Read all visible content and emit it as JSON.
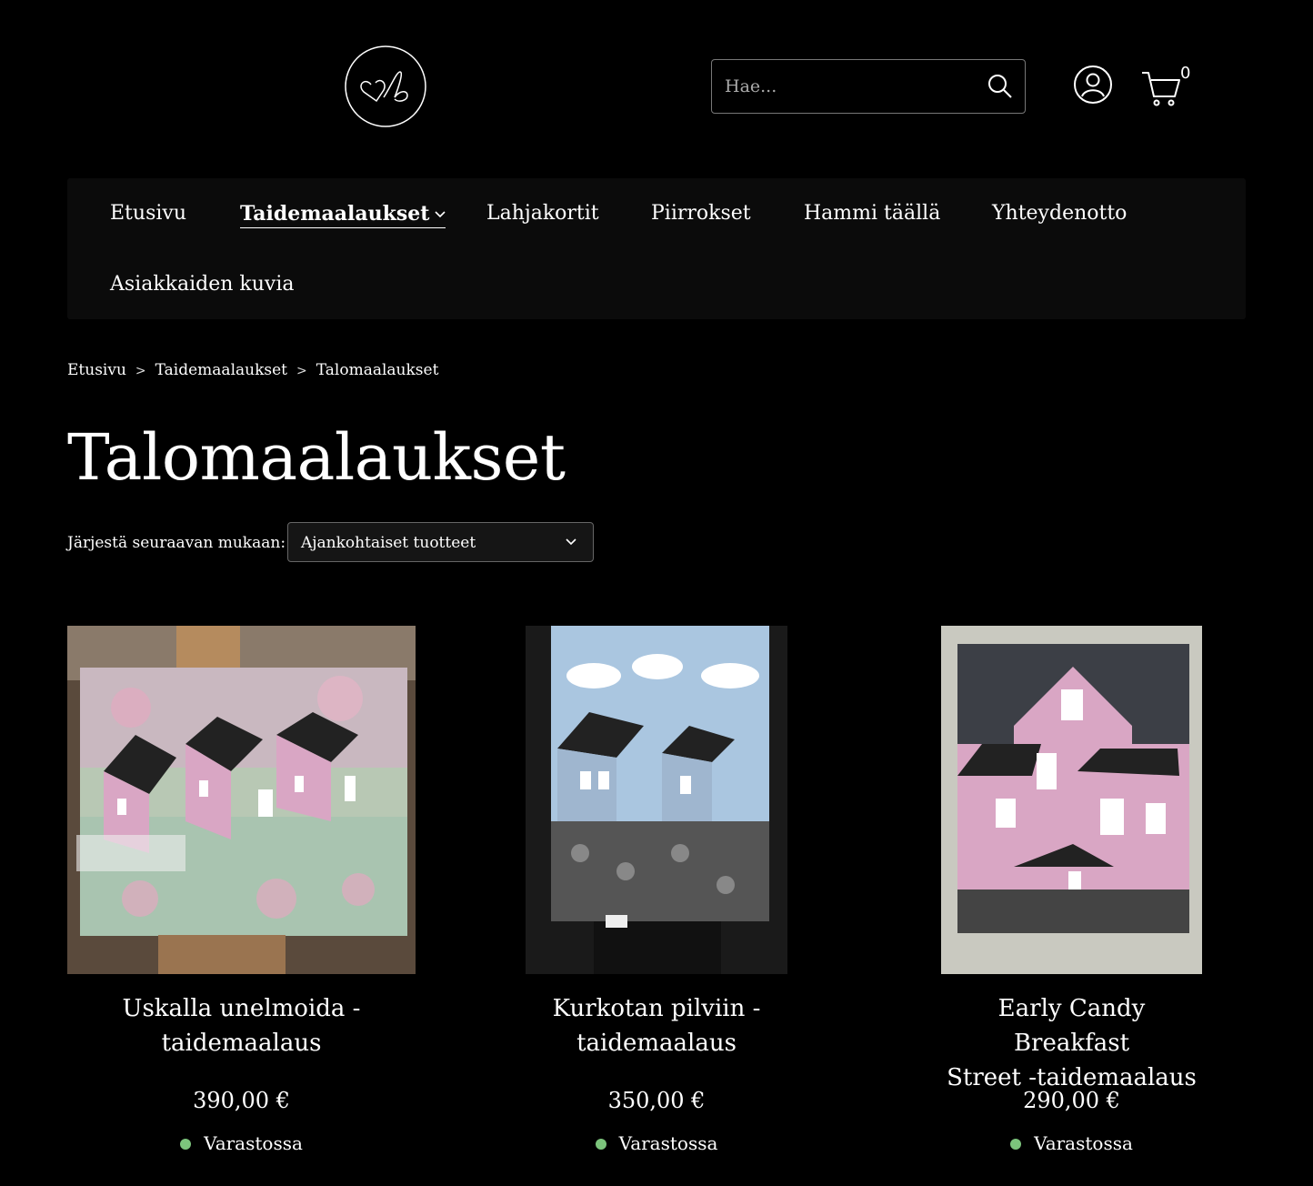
{
  "header": {
    "search_placeholder": "Hae...",
    "cart_count": "0"
  },
  "nav": {
    "items": [
      {
        "label": "Etusivu"
      },
      {
        "label": "Taidemaalaukset",
        "active": true,
        "has_dropdown": true
      },
      {
        "label": "Lahjakortit"
      },
      {
        "label": "Piirrokset"
      },
      {
        "label": "Hammi täällä"
      },
      {
        "label": "Yhteydenotto"
      },
      {
        "label": "Asiakkaiden kuvia"
      }
    ]
  },
  "breadcrumb": {
    "items": [
      "Etusivu",
      "Taidemaalaukset",
      "Talomaalaukset"
    ],
    "separator": ">"
  },
  "page": {
    "title": "Talomaalaukset"
  },
  "sort": {
    "label": "Järjestä seuraavan mukaan:",
    "selected": "Ajankohtaiset tuotteet"
  },
  "products": [
    {
      "name_line1": "Uskalla unelmoida -",
      "name_line2": "taidemaalaus",
      "price": "390,00 €",
      "stock": "Varastossa"
    },
    {
      "name_line1": "Kurkotan pilviin -",
      "name_line2": "taidemaalaus",
      "price": "350,00 €",
      "stock": "Varastossa"
    },
    {
      "name_line1": "Early Candy Breakfast",
      "name_line2": "Street -taidemaalaus",
      "price": "290,00 €",
      "stock": "Varastossa"
    }
  ],
  "colors": {
    "background": "#000000",
    "nav_background": "#0b0b0b",
    "stock_dot": "#7cc47c",
    "house_pink": "#d9a6c4",
    "house_blue": "#9fb6cf"
  }
}
